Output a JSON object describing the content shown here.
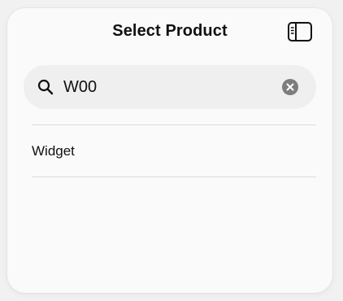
{
  "dialog": {
    "title": "Select Product"
  },
  "search": {
    "value": "W00",
    "placeholder": "Search"
  },
  "results": [
    {
      "label": "Widget"
    }
  ],
  "icons": {
    "search": "magnifying-glass-icon",
    "clear": "clear-circle-icon",
    "sidebar": "sidebar-toggle-icon"
  },
  "colors": {
    "caret": "#1d6ef5",
    "clear_icon": "#7d7d7d"
  }
}
